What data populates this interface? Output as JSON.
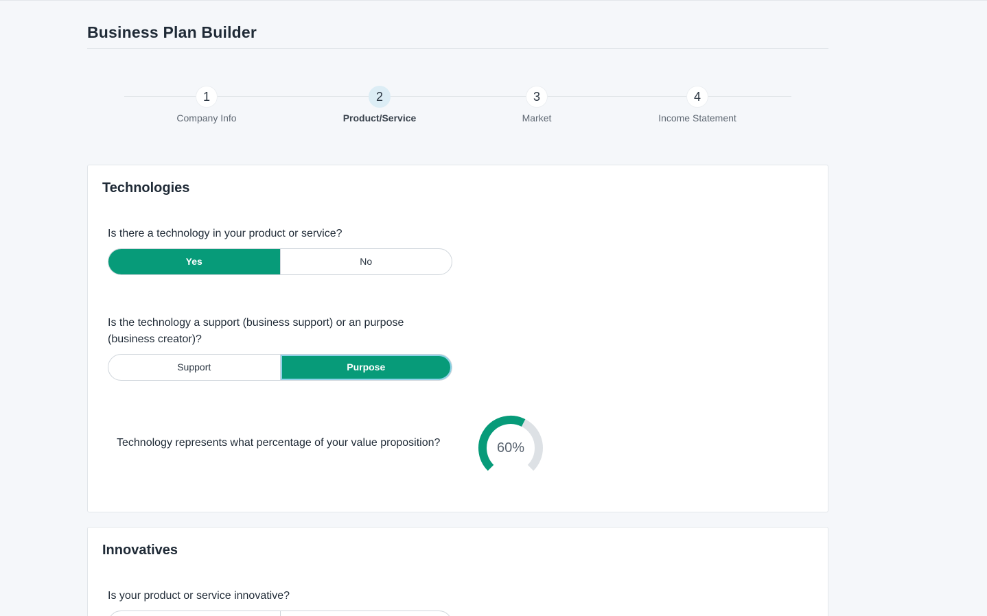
{
  "header": {
    "title": "Business Plan Builder"
  },
  "stepper": {
    "steps": [
      {
        "number": "1",
        "label": "Company Info"
      },
      {
        "number": "2",
        "label": "Product/Service"
      },
      {
        "number": "3",
        "label": "Market"
      },
      {
        "number": "4",
        "label": "Income Statement"
      }
    ],
    "active_step": "2"
  },
  "technologies": {
    "title": "Technologies",
    "q1": {
      "text": "Is there a technology in your product or service?",
      "options": [
        "Yes",
        "No"
      ],
      "selected": "Yes"
    },
    "q2": {
      "text": "Is the technology a support (business support) or an purpose (business creator)?",
      "options": [
        "Support",
        "Purpose"
      ],
      "selected": "Purpose"
    },
    "q3": {
      "text": "Technology represents what percentage of your value proposition?",
      "value_label": "60%",
      "value": 60
    }
  },
  "innovatives": {
    "title": "Innovatives",
    "q1": {
      "text": "Is your product or service innovative?"
    }
  },
  "colors": {
    "accent": "#079b79",
    "track": "#dde1e5",
    "active_step_bg": "#dcedf5"
  }
}
